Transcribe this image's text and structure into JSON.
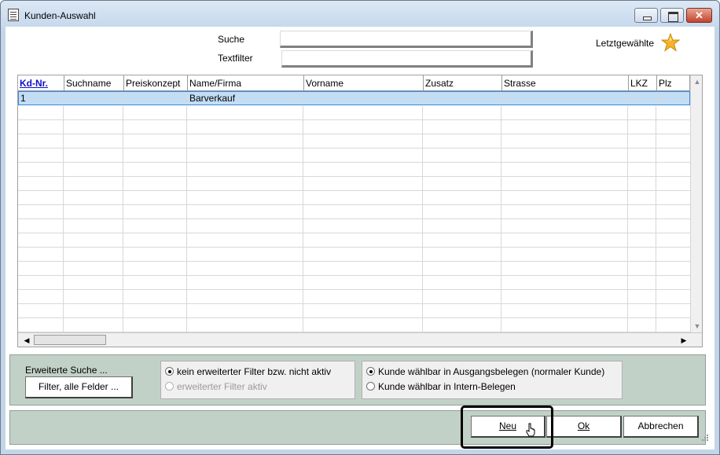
{
  "window": {
    "title": "Kunden-Auswahl"
  },
  "search": {
    "label": "Suche",
    "value": ""
  },
  "textfilter": {
    "label": "Textfilter",
    "value": ""
  },
  "recent": {
    "label": "Letztgewählte",
    "icon": "star-icon",
    "color": "#f5b325"
  },
  "grid": {
    "columns": [
      "Kd-Nr.",
      "Suchname",
      "Preiskonzept",
      "Name/Firma",
      "Vorname",
      "Zusatz",
      "Strasse",
      "LKZ",
      "Plz"
    ],
    "sorted_column": "Kd-Nr.",
    "rows": [
      {
        "kdnr": "1",
        "suchname": "",
        "preiskonzept": "",
        "name": "Barverkauf",
        "vorname": "",
        "zusatz": "",
        "strasse": "",
        "lkz": "",
        "plz": ""
      }
    ],
    "selected_color": "#c3ddf5"
  },
  "extended": {
    "title": "Erweiterte Suche ...",
    "filter_button": "Filter, alle Felder ...",
    "radio_no_filter": "kein erweiterter Filter bzw. nicht aktiv",
    "radio_filter_active": "erweiterter Filter aktiv"
  },
  "customer_type": {
    "radio_normal": "Kunde wählbar in Ausgangsbelegen (normaler Kunde)",
    "radio_internal": "Kunde wählbar in Intern-Belegen"
  },
  "buttons": {
    "new": "Neu",
    "ok": "Ok",
    "cancel": "Abbrechen"
  }
}
